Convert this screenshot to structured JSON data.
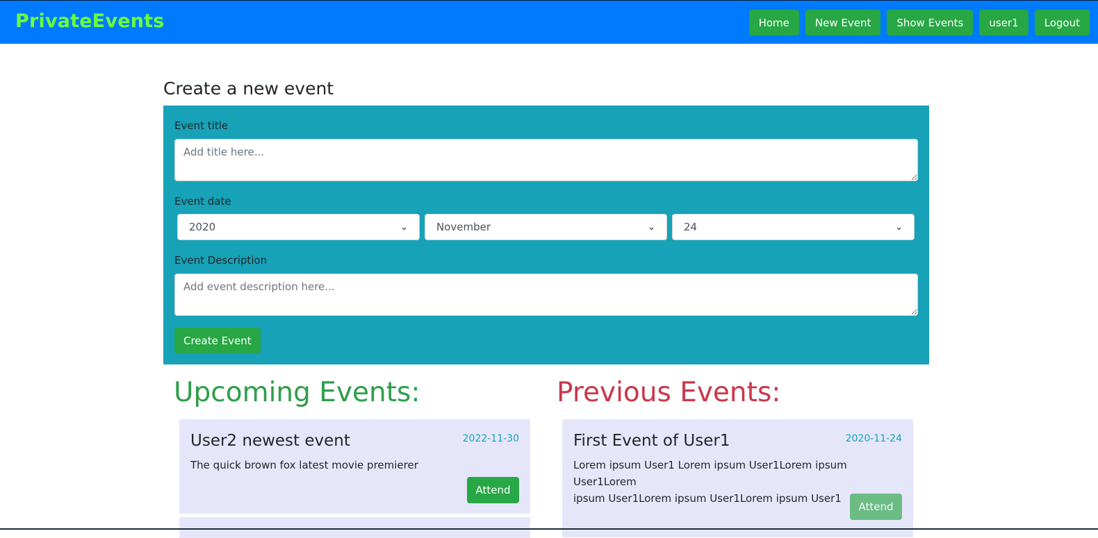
{
  "navbar": {
    "brand": "PrivateEvents",
    "links": [
      "Home",
      "New Event",
      "Show Events",
      "user1",
      "Logout"
    ]
  },
  "form": {
    "heading": "Create a new event",
    "title_label": "Event title",
    "title_placeholder": "Add title here...",
    "date_label": "Event date",
    "year": "2020",
    "month": "November",
    "day": "24",
    "description_label": "Event Description",
    "description_placeholder": "Add event description here...",
    "submit_label": "Create Event"
  },
  "upcoming": {
    "heading": "Upcoming Events:",
    "events": [
      {
        "title": "User2 newest event",
        "date": "2022-11-30",
        "description": "The quick brown fox latest movie premierer",
        "attend_label": "Attend"
      }
    ]
  },
  "previous": {
    "heading": "Previous Events:",
    "events": [
      {
        "title": "First Event of User1",
        "date": "2020-11-24",
        "description_lines": [
          "Lorem ipsum User1 Lorem ipsum User1Lorem ipsum User1Lorem",
          "ipsum User1Lorem ipsum User1Lorem ipsum User1"
        ],
        "attend_label": "Attend"
      }
    ]
  },
  "colors": {
    "navbar": "#007bff",
    "brand": "#6cff3a",
    "button": "#28a745",
    "form_bg": "#17a2b8",
    "card_bg": "#e6e6fa",
    "upcoming_heading": "#2e9e4a",
    "previous_heading": "#c9374a"
  },
  "icons": [
    "chevron-down-icon"
  ]
}
